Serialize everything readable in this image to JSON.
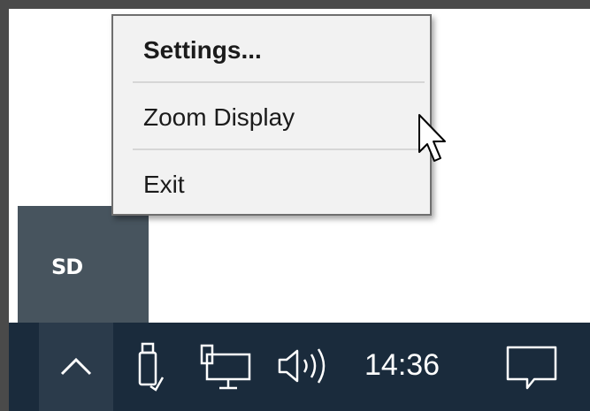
{
  "context_menu": {
    "items": [
      {
        "label": "Settings...",
        "bold": true
      },
      {
        "label": "Zoom Display",
        "bold": false
      },
      {
        "label": "Exit",
        "bold": false
      }
    ]
  },
  "tray_flyout": {
    "app_icon_label": "SD"
  },
  "taskbar": {
    "clock": "14:36",
    "icons": [
      "chevron-up-icon",
      "usb-drive-icon",
      "network-icon",
      "speaker-icon",
      "action-center-icon"
    ]
  },
  "colors": {
    "taskbar": "#1a2b3c",
    "taskbar_hover": "#2b3b4b",
    "flyout": "#47545e",
    "menu_bg": "#f2f2f2",
    "menu_border": "#6f6f6f"
  }
}
